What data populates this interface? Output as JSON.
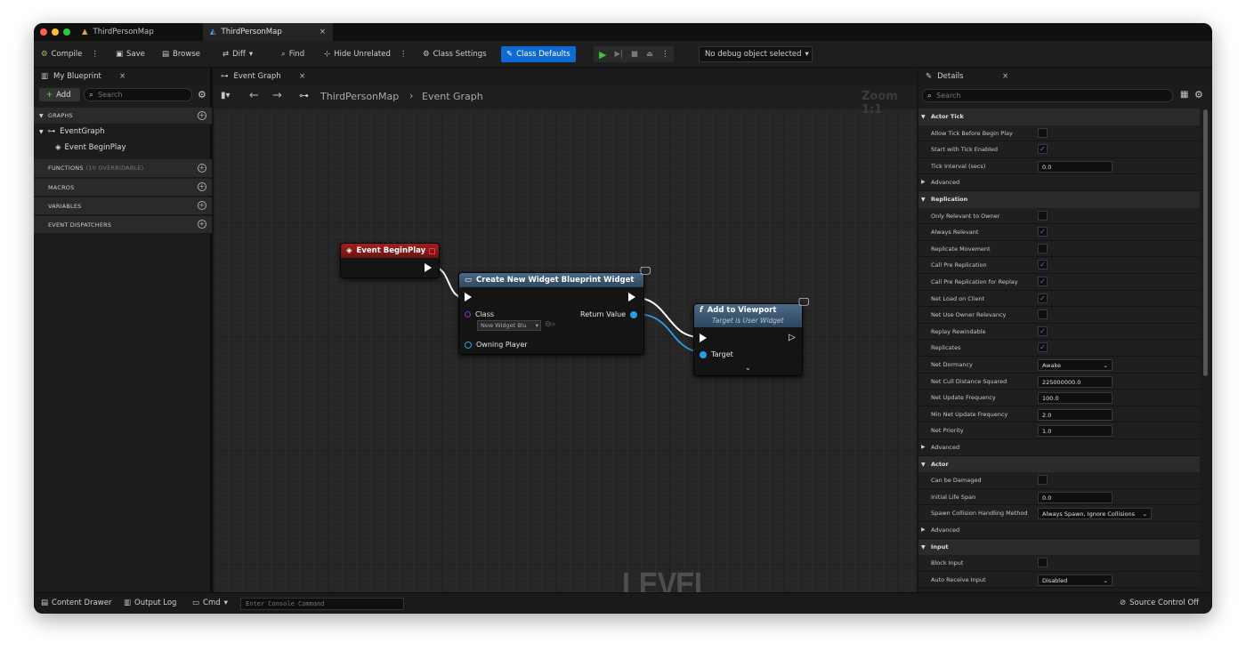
{
  "window": {
    "tabs": [
      {
        "label": "ThirdPersonMap",
        "active": false
      },
      {
        "label": "ThirdPersonMap",
        "active": true
      }
    ]
  },
  "toolbar": {
    "compile": "Compile",
    "save": "Save",
    "browse": "Browse",
    "diff": "Diff",
    "find": "Find",
    "hide_unrelated": "Hide Unrelated",
    "class_settings": "Class Settings",
    "class_defaults": "Class Defaults",
    "debug_object": "No debug object selected"
  },
  "my_blueprint": {
    "tab": "My Blueprint",
    "add": "Add",
    "search_placeholder": "Search",
    "sections": {
      "graphs": "GRAPHS",
      "functions": "FUNCTIONS",
      "functions_note": "(10 OVERRIDABLE)",
      "macros": "MACROS",
      "variables": "VARIABLES",
      "dispatchers": "EVENT DISPATCHERS"
    },
    "tree": {
      "event_graph": "EventGraph",
      "begin_play": "Event BeginPlay"
    }
  },
  "graph": {
    "tab": "Event Graph",
    "breadcrumb_root": "ThirdPersonMap",
    "breadcrumb_leaf": "Event Graph",
    "zoom": "Zoom 1:1",
    "watermark": "LEVEL BLUEPRINT",
    "nodes": {
      "begin_play": {
        "title": "Event BeginPlay"
      },
      "create_widget": {
        "title": "Create New Widget Blueprint Widget",
        "class_label": "Class",
        "class_value": "New Widget Blu",
        "owning_player": "Owning Player",
        "return_value": "Return Value"
      },
      "add_to_viewport": {
        "title": "Add to Viewport",
        "subtitle": "Target is User Widget",
        "target": "Target"
      }
    }
  },
  "details": {
    "tab": "Details",
    "search_placeholder": "Search",
    "sections": {
      "actor_tick": "Actor Tick",
      "replication": "Replication",
      "actor": "Actor",
      "input": "Input",
      "advanced": "Advanced"
    },
    "actor_tick": [
      {
        "label": "Allow Tick Before Begin Play",
        "checked": false
      },
      {
        "label": "Start with Tick Enabled",
        "checked": true
      },
      {
        "label": "Tick Interval (secs)",
        "value": "0.0"
      }
    ],
    "replication": [
      {
        "label": "Only Relevant to Owner",
        "checked": false
      },
      {
        "label": "Always Relevant",
        "checked": true
      },
      {
        "label": "Replicate Movement",
        "checked": false
      },
      {
        "label": "Call Pre Replication",
        "checked": true
      },
      {
        "label": "Call Pre Replication for Replay",
        "checked": true
      },
      {
        "label": "Net Load on Client",
        "checked": true
      },
      {
        "label": "Net Use Owner Relevancy",
        "checked": false
      },
      {
        "label": "Replay Rewindable",
        "checked": true
      },
      {
        "label": "Replicates",
        "checked": true
      },
      {
        "label": "Net Dormancy",
        "dropdown": "Awake"
      },
      {
        "label": "Net Cull Distance Squared",
        "value": "225000000.0"
      },
      {
        "label": "Net Update Frequency",
        "value": "100.0"
      },
      {
        "label": "Min Net Update Frequency",
        "value": "2.0"
      },
      {
        "label": "Net Priority",
        "value": "1.0"
      }
    ],
    "actor": [
      {
        "label": "Can be Damaged",
        "checked": false
      },
      {
        "label": "Initial Life Span",
        "value": "0.0"
      },
      {
        "label": "Spawn Collision Handling Method",
        "dropdown": "Always Spawn, Ignore Collisions"
      }
    ],
    "input": [
      {
        "label": "Block Input",
        "checked": false
      },
      {
        "label": "Auto Receive Input",
        "dropdown": "Disabled"
      }
    ]
  },
  "statusbar": {
    "content_drawer": "Content Drawer",
    "output_log": "Output Log",
    "cmd": "Cmd",
    "console_placeholder": "Enter Console Command",
    "source_control": "Source Control Off"
  },
  "colors": {
    "accent": "#0e6ad3",
    "event_header": "#8b1a1a",
    "function_header": "#3d5670",
    "play": "#3fbf3f"
  }
}
